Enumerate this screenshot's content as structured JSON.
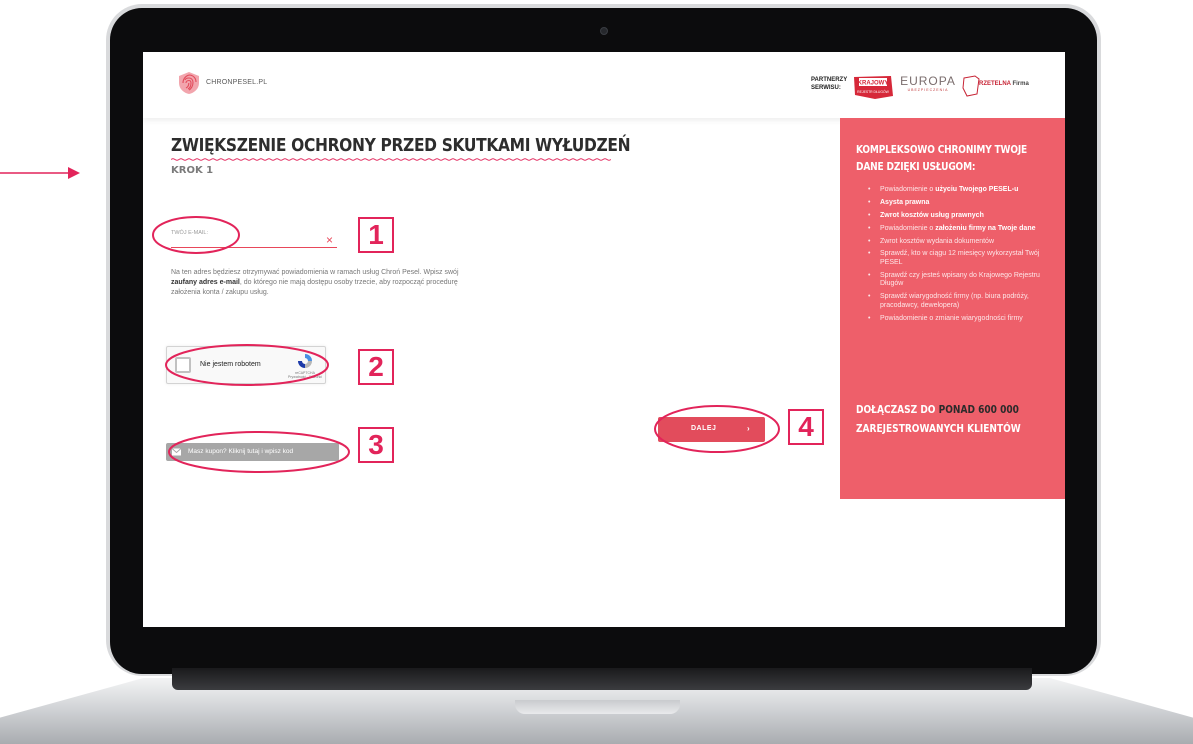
{
  "header": {
    "brand_name": "CHRONPESEL.PL",
    "partners_label": "PARTNERZY SERWISU:",
    "partners": [
      {
        "name": "KRAJOWY",
        "sub": "REJESTR DŁUGÓW"
      },
      {
        "name": "EUROPA",
        "sub": "UBEZPIECZENIA"
      },
      {
        "name": "RZETELNA",
        "suffix": "Firma"
      }
    ]
  },
  "main": {
    "title": "ZWIĘKSZENIE OCHRONY PRZED SKUTKAMI WYŁUDZEŃ",
    "step": "KROK 1",
    "email": {
      "label": "TWÓJ E-MAIL:",
      "value": "",
      "clear_icon": "close-icon",
      "help_text_1": "Na ten adres będziesz otrzymywać powiadomienia w ramach usług Chroń Pesel. Wpisz swój ",
      "help_text_bold": "zaufany adres e-mail",
      "help_text_2": ", do którego nie mają dostępu osoby trzecie, aby rozpocząć procedurę założenia konta / zakupu usług."
    },
    "recaptcha": {
      "label": "Nie jestem robotem",
      "brand": "reCAPTCHA",
      "links": "Prywatność - Warunki"
    },
    "coupon_button": "Masz kupon? Kliknij tutaj i wpisz kod",
    "next_button": "DALEJ",
    "next_arrow": "›"
  },
  "promo": {
    "heading": "KOMPLEKSOWO CHRONIMY TWOJE DANE DZIĘKI USŁUGOM:",
    "items": [
      {
        "pre": "Powiadomienie o ",
        "bold": "użyciu Twojego PESEL-u",
        "post": ""
      },
      {
        "pre": "",
        "bold": "Asysta prawna",
        "post": ""
      },
      {
        "pre": "",
        "bold": "Zwrot kosztów usług prawnych",
        "post": ""
      },
      {
        "pre": "Powiadomienie o ",
        "bold": "założeniu firmy na Twoje dane",
        "post": ""
      },
      {
        "pre": "Zwrot kosztów wydania dokumentów",
        "bold": "",
        "post": ""
      },
      {
        "pre": "Sprawdź, kto w ciągu 12 miesięcy wykorzystał Twój PESEL",
        "bold": "",
        "post": ""
      },
      {
        "pre": "Sprawdź czy jesteś wpisany do Krajowego Rejestru Długów",
        "bold": "",
        "post": ""
      },
      {
        "pre": "Sprawdź wiarygodność firmy (np. biura podróży, pracodawcy, dewelopera)",
        "bold": "",
        "post": ""
      },
      {
        "pre": "Powiadomienie o zmianie wiarygodności firmy",
        "bold": "",
        "post": ""
      }
    ],
    "footer_1": "DOŁĄCZASZ DO ",
    "footer_highlight": "PONAD 600 000",
    "footer_2": "ZAREJESTROWANYCH KLIENTÓW"
  },
  "annotations": {
    "step_badges": [
      "1",
      "2",
      "3",
      "4"
    ],
    "accent_color": "#e2245a"
  },
  "colors": {
    "brand_red": "#ee5f6a",
    "button_red": "#e24c5c",
    "coupon_gray": "#a7a7a7"
  }
}
